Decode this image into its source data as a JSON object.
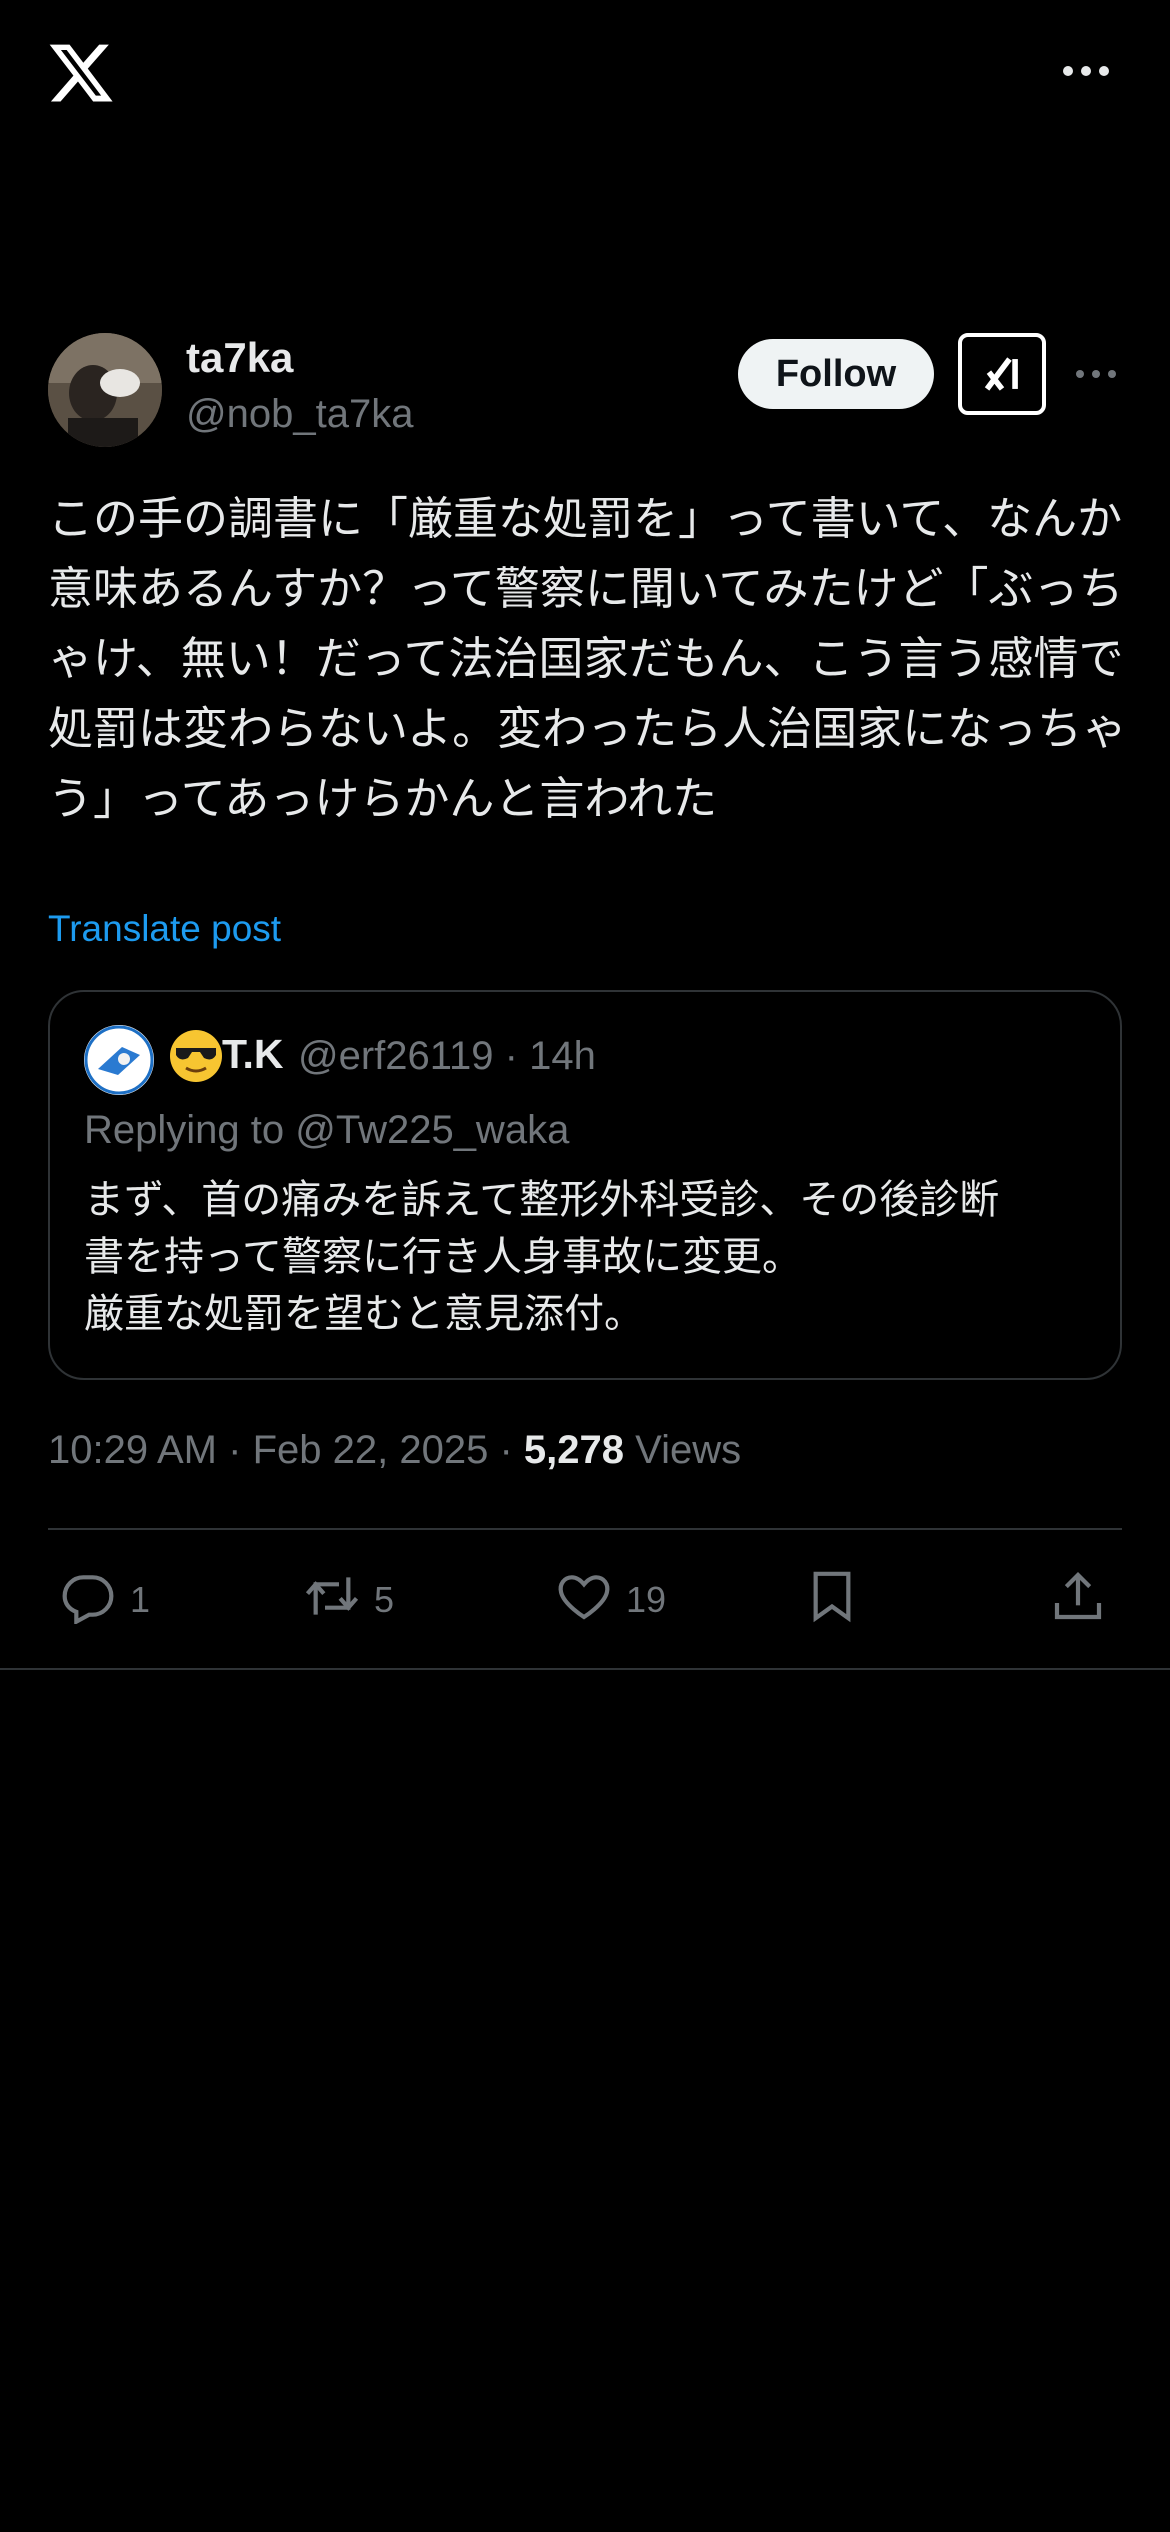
{
  "author": {
    "name": "ta7ka",
    "handle": "@nob_ta7ka",
    "follow_label": "Follow"
  },
  "post": {
    "text": "この手の調書に「厳重な処罰を」って書いて、なんか意味あるんすか？って警察に聞いてみたけど「ぶっちゃけ、無い！だって法治国家だもん、こう言う感情で処罰は変わらないよ。変わったら人治国家になっちゃう」ってあっけらかんと言われた",
    "translate_label": "Translate post"
  },
  "quote": {
    "name": "T.K",
    "handle": "@erf26119",
    "time": "14h",
    "separator": "·",
    "replying_to": "Replying to @Tw225_waka",
    "text": "まず、首の痛みを訴えて整形外科受診、その後診断\n書を持って警察に行き人身事故に変更。\n厳重な処罰を望むと意見添付。"
  },
  "meta": {
    "time": "10:29 AM",
    "date": "Feb 22, 2025",
    "separator": "·",
    "views_count": "5,278",
    "views_label": "Views"
  },
  "actions": {
    "replies": "1",
    "reposts": "5",
    "likes": "19"
  },
  "icons": {
    "logo": "x-logo-icon",
    "more": "more-icon",
    "grok": "grok-icon",
    "reply": "reply-icon",
    "repost": "repost-icon",
    "like": "heart-icon",
    "bookmark": "bookmark-icon",
    "share": "share-icon"
  },
  "colors": {
    "background": "#000000",
    "text": "#e7e9ea",
    "secondary": "#71767b",
    "link": "#1d9bf0",
    "border": "#2f3336",
    "follow_bg": "#eff3f4"
  }
}
